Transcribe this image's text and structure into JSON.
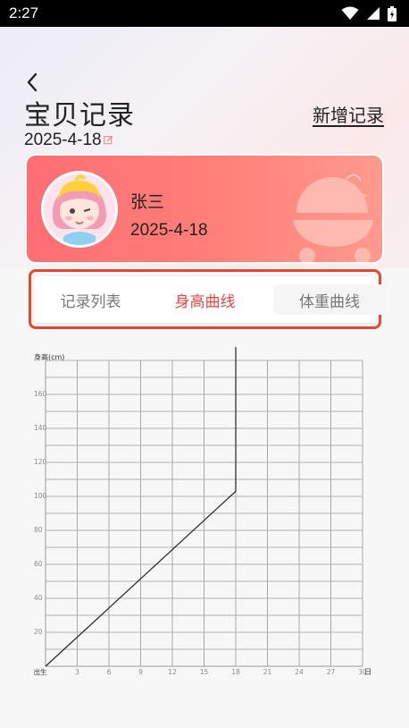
{
  "status_bar": {
    "time": "2:27"
  },
  "header": {
    "title": "宝贝记录",
    "date": "2025-4-18",
    "add_label": "新增记录"
  },
  "profile": {
    "name": "张三",
    "birth_date": "2025-4-18"
  },
  "tabs": [
    {
      "label": "记录列表",
      "active": false
    },
    {
      "label": "身高曲线",
      "active": true
    },
    {
      "label": "体重曲线",
      "active": false
    }
  ],
  "colors": {
    "accent": "#e84545",
    "card_start": "#ff6e73",
    "card_end": "#ff9a8f",
    "highlight_border": "#e5472e"
  },
  "chart_data": {
    "type": "line",
    "ylabel": "身高(cm)",
    "xlabel": "日",
    "x_tick_labels": [
      "出生",
      "3",
      "6",
      "9",
      "12",
      "15",
      "18",
      "21",
      "24",
      "27",
      "30"
    ],
    "y_tick_labels": [
      "20",
      "40",
      "60",
      "80",
      "100",
      "120",
      "140",
      "160"
    ],
    "xlim": [
      0,
      30
    ],
    "ylim": [
      0,
      180
    ],
    "grid": true,
    "series": [
      {
        "x": [
          0,
          18,
          18
        ],
        "y": [
          0,
          103,
          200
        ]
      }
    ]
  }
}
